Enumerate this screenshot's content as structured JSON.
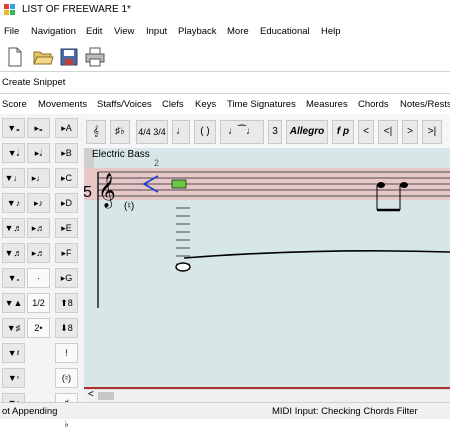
{
  "window": {
    "title": "LIST OF FREEWARE 1*"
  },
  "menu": [
    "File",
    "Navigation",
    "Edit",
    "View",
    "Input",
    "Playback",
    "More",
    "Educational",
    "Help"
  ],
  "toolbar_icons": [
    "new-file-icon",
    "open-folder-icon",
    "save-icon",
    "print-icon"
  ],
  "snippet_label": "Create Snippet",
  "tabs": [
    "Score",
    "Movements",
    "Staffs/Voices",
    "Clefs",
    "Keys",
    "Time Signatures",
    "Measures",
    "Chords",
    "Notes/Rests"
  ],
  "commands": {
    "time_sig": "4/4 3/4",
    "parens": "( )",
    "triplet": "3",
    "tempo": "Allegro",
    "dynamic": "f p",
    "nav": [
      "<",
      "<|",
      ">",
      ">|"
    ]
  },
  "palette": {
    "col1": [
      "▼𝅝",
      "▼𝅗𝅥",
      "▼♩",
      "▼♪",
      "▼♬",
      "▼♬",
      "▼𝅗",
      "▼▲",
      "▼♯",
      "▼𝄽",
      "▼𝄾",
      "▼𝄿",
      "▼𝅀"
    ],
    "col2": [
      "▸𝅝",
      "▸𝅗𝅥",
      "▸♩",
      "▸♪",
      "▸♬",
      "▸♬",
      "·",
      "1/2",
      "2•"
    ],
    "col3": [
      "▸A",
      "▸B",
      "▸C",
      "▸D",
      "▸E",
      "▸F",
      "▸G",
      "⬆8",
      "⬇8",
      "!",
      "(♮)",
      "♯",
      "♭"
    ]
  },
  "score": {
    "staff_name": "Electric Bass",
    "measure_number": "2",
    "clef_number": "5",
    "natural_hint": "(♮)"
  },
  "status": {
    "left": "ot Appending",
    "right": "MIDI Input: Checking Chords Filter"
  },
  "colors": {
    "score_bg": "#d7e6e6",
    "staff_highlight": "#e6c8c8",
    "cursor": "#2a3cd8",
    "note_green": "#66cc44"
  }
}
